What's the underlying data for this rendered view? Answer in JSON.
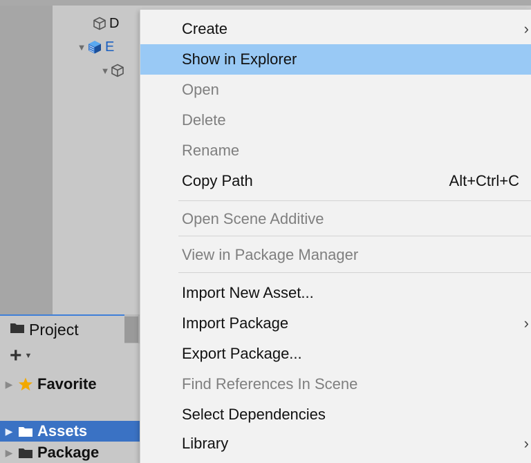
{
  "hierarchy": {
    "rows": [
      {
        "label": "D",
        "icon": "cube-outline-icon"
      },
      {
        "label": "E",
        "icon": "prefab-cube-icon"
      },
      {
        "label": "",
        "icon": "cube-outline-icon"
      }
    ]
  },
  "project_panel": {
    "tab_label": "Project",
    "add_icon": "plus-icon",
    "tree": [
      {
        "label": "Favorite",
        "icon": "star-icon"
      },
      {
        "label": "Assets",
        "icon": "folder-icon",
        "selected": true
      },
      {
        "label": "Package",
        "icon": "folder-icon"
      }
    ]
  },
  "context_menu": {
    "items": [
      {
        "label": "Create",
        "submenu": true
      },
      {
        "label": "Show in Explorer",
        "highlighted": true
      },
      {
        "label": "Open",
        "disabled": true
      },
      {
        "label": "Delete",
        "disabled": true
      },
      {
        "label": "Rename",
        "disabled": true
      },
      {
        "label": "Copy Path",
        "shortcut": "Alt+Ctrl+C"
      },
      {
        "label": "Open Scene Additive",
        "disabled": true
      },
      {
        "label": "View in Package Manager",
        "disabled": true
      },
      {
        "label": "Import New Asset..."
      },
      {
        "label": "Import Package",
        "submenu": true
      },
      {
        "label": "Export Package..."
      },
      {
        "label": "Find References In Scene",
        "disabled": true
      },
      {
        "label": "Select Dependencies"
      },
      {
        "label": "Library",
        "submenu": true
      }
    ],
    "submenu_glyph": "›"
  },
  "colors": {
    "highlight": "#99c9f5",
    "selection": "#3a72c4",
    "menu_bg": "#f2f2f2",
    "star": "#f2a900"
  }
}
